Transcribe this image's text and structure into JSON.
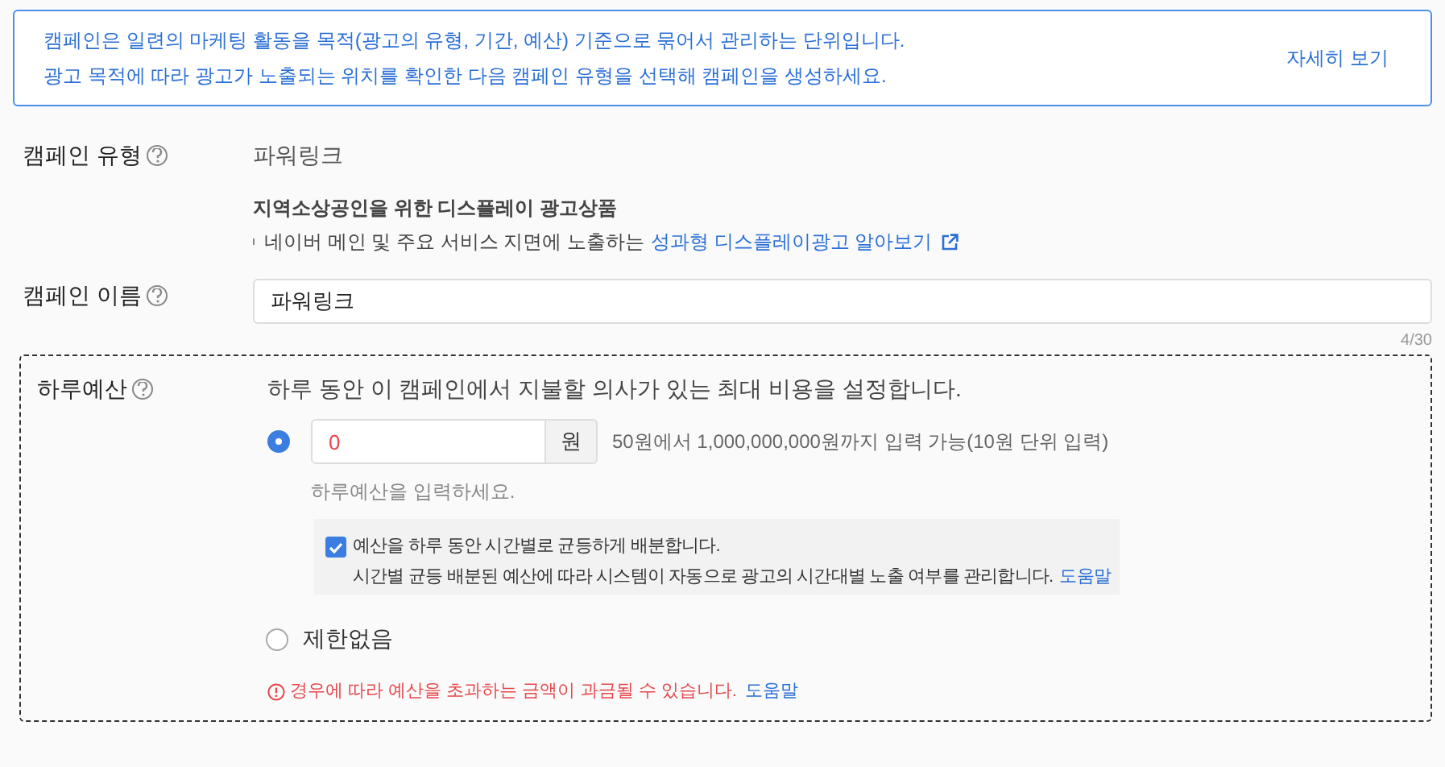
{
  "notice": {
    "lines": [
      "캠페인은 일련의 마케팅 활동을 목적(광고의 유형, 기간, 예산) 기준으로 묶어서 관리하는 단위입니다.",
      "광고 목적에 따라 광고가 노출되는 위치를 확인한 다음 캠페인 유형을 선택해 캠페인을 생성하세요."
    ],
    "link": "자세히 보기"
  },
  "campaign_type": {
    "label": "캠페인 유형",
    "value": "파워링크",
    "promo_title": "지역소상공인을 위한 디스플레이 광고상품",
    "promo_text": "네이버 메인 및 주요 서비스 지면에 노출하는",
    "promo_link": "성과형 디스플레이광고 알아보기"
  },
  "campaign_name": {
    "label": "캠페인 이름",
    "value": "파워링크",
    "counter": "4/30"
  },
  "daily_budget": {
    "label": "하루예산",
    "description": "하루 동안 이 캠페인에서 지불할 의사가 있는 최대 비용을 설정합니다.",
    "options": [
      {
        "kind": "amount",
        "selected": true,
        "value": "0",
        "unit": "원",
        "range": "50원에서 1,000,000,000원까지 입력 가능(10원 단위 입력)",
        "hint": "하루예산을 입력하세요.",
        "even_split": {
          "checked": true,
          "title": "예산을 하루 동안 시간별로 균등하게 배분합니다.",
          "text": "시간별 균등 배분된 예산에 따라 시스템이 자동으로 광고의 시간대별 노출 여부를 관리합니다.",
          "link": "도움말"
        }
      },
      {
        "kind": "unlimited",
        "selected": false,
        "label": "제한없음"
      }
    ],
    "warning": {
      "text": "경우에 따라 예산을 초과하는 금액이 과금될 수 있습니다.",
      "link": "도움말"
    }
  }
}
